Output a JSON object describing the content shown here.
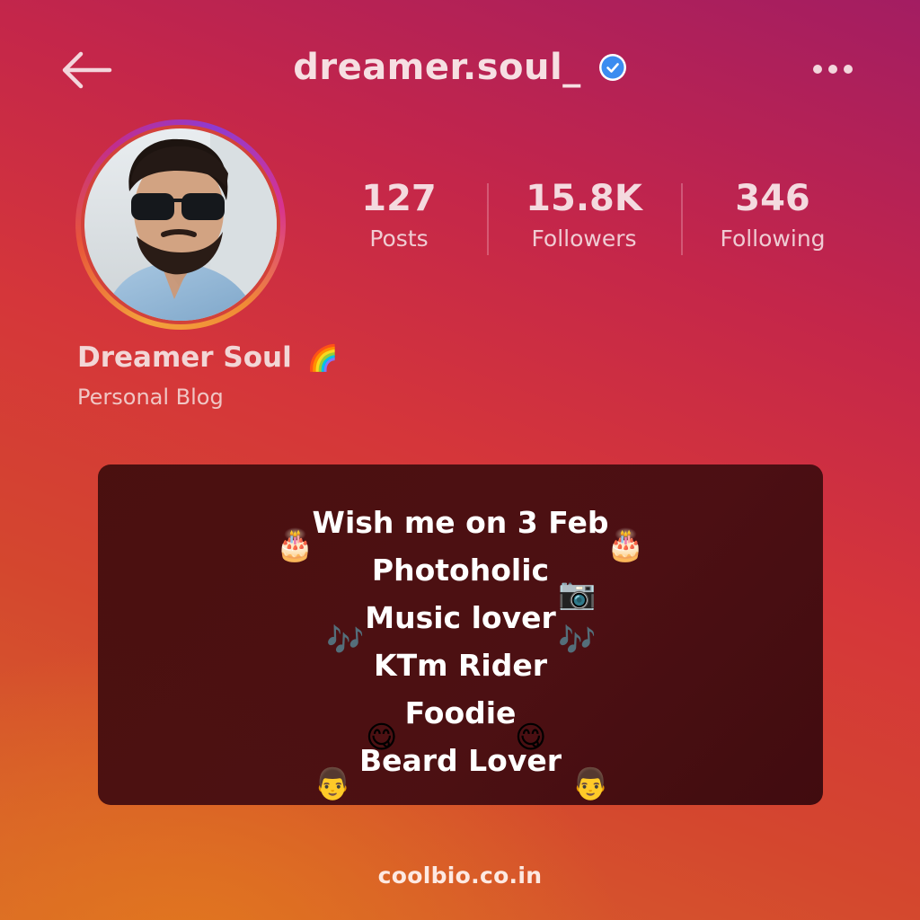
{
  "header": {
    "username": "dreamer.soul_",
    "verified": true,
    "back_icon": "arrow-left-icon",
    "more_icon": "more-horizontal-icon"
  },
  "profile": {
    "display_name": "Dreamer Soul",
    "name_emoji": "🌈",
    "category": "Personal Blog",
    "avatar_icon": "profile-photo-avatar"
  },
  "stats": [
    {
      "value": "127",
      "label": "Posts"
    },
    {
      "value": "15.8K",
      "label": "Followers"
    },
    {
      "value": "346",
      "label": "Following"
    }
  ],
  "bio": {
    "lines": [
      "Wish me on 3 Feb",
      "Photoholic",
      "Music lover",
      "KTm Rider",
      "Foodie",
      "Beard Lover"
    ],
    "emojis": {
      "cake": "🎂",
      "camera": "📷",
      "music": "🎶",
      "yum": "😋",
      "beard": "👨"
    }
  },
  "footer": {
    "text": "coolbio.co.in"
  },
  "colors": {
    "verified_blue": "#3b8cf0",
    "card_bg": "#460f0e",
    "text_light": "#f6dfe2"
  }
}
